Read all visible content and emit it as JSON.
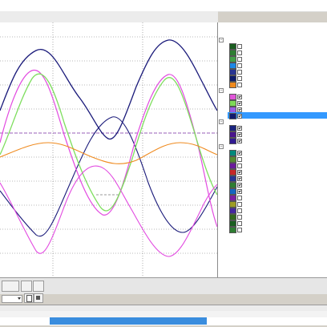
{
  "window": {
    "title": "",
    "pane_title": ""
  },
  "tabs": [
    {
      "label": ""
    },
    {
      "label": ""
    },
    {
      "label": ""
    }
  ],
  "columns": {
    "color": "",
    "check": "",
    "name": ""
  },
  "sections": [
    {
      "label": "",
      "rows": [
        {
          "color": "#1b5e20",
          "checked": false,
          "name": ""
        },
        {
          "color": "#2e7d32",
          "checked": false,
          "name": ""
        },
        {
          "color": "#43a047",
          "checked": false,
          "name": ""
        },
        {
          "color": "#1e88e5",
          "checked": false,
          "name": ""
        },
        {
          "color": "#283593",
          "checked": false,
          "name": ""
        },
        {
          "color": "#0d1b6b",
          "checked": false,
          "name": ""
        },
        {
          "color": "#ef8a1e",
          "checked": false,
          "name": ""
        }
      ]
    },
    {
      "label": "",
      "rows": [
        {
          "color": "#e056d8",
          "checked": true,
          "name": ""
        },
        {
          "color": "#7ed957",
          "checked": true,
          "name": ""
        },
        {
          "color": "#9b5de5",
          "checked": true,
          "name": ""
        },
        {
          "color": "#111a6e",
          "checked": true,
          "name": "",
          "selected": true
        }
      ]
    },
    {
      "label": "",
      "rows": [
        {
          "color": "#1a237e",
          "checked": true,
          "name": ""
        },
        {
          "color": "#4a148c",
          "checked": true,
          "name": ""
        },
        {
          "color": "#311b92",
          "checked": true,
          "name": ""
        }
      ]
    },
    {
      "label": "",
      "rows": [
        {
          "color": "#00897b",
          "checked": true,
          "name": ""
        },
        {
          "color": "#558b2f",
          "checked": false,
          "name": ""
        },
        {
          "color": "#6a1b9a",
          "checked": false,
          "name": ""
        },
        {
          "color": "#c62828",
          "checked": true,
          "name": ""
        },
        {
          "color": "#283593",
          "checked": true,
          "name": ""
        },
        {
          "color": "#2e7d32",
          "checked": true,
          "name": ""
        },
        {
          "color": "#1565c0",
          "checked": true,
          "name": ""
        },
        {
          "color": "#7b1fa2",
          "checked": false,
          "name": ""
        },
        {
          "color": "#9e9d24",
          "checked": false,
          "name": ""
        },
        {
          "color": "#4527a0",
          "checked": false,
          "name": ""
        },
        {
          "color": "#33691e",
          "checked": false,
          "name": ""
        },
        {
          "color": "#1b5e20",
          "checked": false,
          "name": ""
        },
        {
          "color": "#2e7d32",
          "checked": false,
          "name": ""
        }
      ]
    }
  ],
  "plot": {
    "x_labels": [
      "",
      ""
    ],
    "colors": {
      "navy": "#1a1a7a",
      "magenta": "#e24ae0",
      "green": "#7ede5e",
      "orange": "#ef8a1e",
      "purple": "#7e30a8",
      "grid": "#777777"
    }
  },
  "status": {
    "header": "",
    "columns": {
      "value": "",
      "time": "",
      "end": ""
    },
    "row": {
      "value": "",
      "time": "",
      "end": ""
    }
  },
  "toolbar": {
    "combo_value": ""
  }
}
